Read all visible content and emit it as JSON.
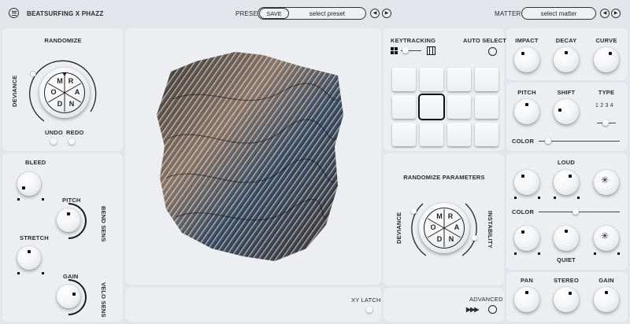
{
  "header": {
    "brand": "BEATSURFING X PHAZZ",
    "preset_label": "PRESET",
    "save_label": "SAVE",
    "preset_value": "select preset",
    "matter_label": "MATTER",
    "matter_value": "select matter",
    "prev_glyph": "◀",
    "next_glyph": "▶"
  },
  "randomize": {
    "title": "RANDOMIZE",
    "deviance": "DEVIANCE",
    "letters": [
      "R",
      "A",
      "N",
      "D",
      "O",
      "M"
    ],
    "undo": "UNDO",
    "redo": "REDO"
  },
  "left": {
    "bleed": "BLEED",
    "pitch": "PITCH",
    "bend_sens": "BEND SENS",
    "stretch": "STRETCH",
    "gain": "GAIN",
    "velo_sens": "VELO SENS"
  },
  "center": {
    "xy_latch": "XY LATCH"
  },
  "keytracking": {
    "title": "KEYTRACKING",
    "auto_select": "AUTO SELECT",
    "pads": 12,
    "selected_pad": 5
  },
  "randomize_params": {
    "title": "RANDOMIZE PARAMETERS",
    "deviance": "DEVIANCE",
    "instability": "INSTABILITY",
    "letters": [
      "R",
      "A",
      "N",
      "D",
      "O",
      "M"
    ],
    "advanced": "ADVANCED",
    "advanced_glyph": "▶▶▶"
  },
  "right": {
    "impact": "IMPACT",
    "decay": "DECAY",
    "curve": "CURVE",
    "pitch": "PITCH",
    "shift": "SHIFT",
    "type": "TYPE",
    "type_options": "1 2 3 4",
    "color1": "COLOR",
    "color1_value": 0.08,
    "loud": "LOUD",
    "color2": "COLOR",
    "color2_value": 0.45,
    "quiet": "QUIET",
    "pan": "PAN",
    "stereo": "STEREO",
    "gain": "GAIN"
  },
  "colors": {
    "background": "#e3e5ea",
    "panel": "#eceef2",
    "ink": "#1c1c1c"
  }
}
